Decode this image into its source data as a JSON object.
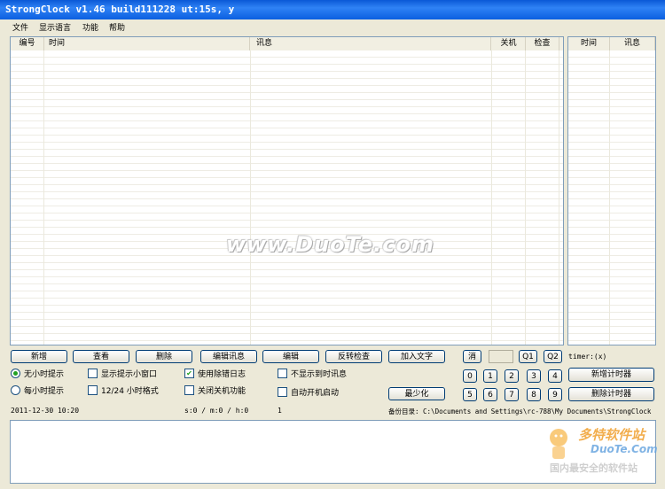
{
  "title": "StrongClock v1.46 build111228 ut:15s, y",
  "menu": [
    "文件",
    "显示语言",
    "功能",
    "帮助"
  ],
  "main_table": {
    "columns": [
      "编号",
      "时间",
      "讯息",
      "关机",
      "检查"
    ]
  },
  "side_table": {
    "columns": [
      "时间",
      "讯息"
    ]
  },
  "watermark": "www.DuoTe.com",
  "buttons": {
    "add": "新增",
    "view": "查看",
    "delete": "删除",
    "edit_msg": "编辑讯息",
    "edit": "编辑",
    "reverse_check": "反转检查",
    "add_text": "加入文字",
    "minimize": "最少化",
    "cancel": "消",
    "q1": "Q1",
    "q2": "Q2",
    "add_timer": "新增计时器",
    "delete_timer": "删除计时器"
  },
  "numpad": [
    "0",
    "1",
    "2",
    "3",
    "4",
    "5",
    "6",
    "7",
    "8",
    "9"
  ],
  "options": {
    "no_hourly": "无小时提示",
    "each_hour": "每小时提示",
    "show_small_window": "显示提示小窗口",
    "format_12_24": "12/24 小时格式",
    "use_debug_log": "使用除错日志",
    "disable_shutdown": "关闭关机功能",
    "hide_expired": "不显示到时讯息",
    "auto_start": "自动开机启动"
  },
  "timer_label": "timer:(x)",
  "status": {
    "datetime": "2011-12-30 10:20",
    "counters": "s:0 / m:0 / h:0",
    "count": "1",
    "backup_dir": "备份目录: C:\\Documents and Settings\\rc-788\\My Documents\\StrongClock"
  },
  "logo": {
    "brand": "多特软件站",
    "site": "DuoTe.Com",
    "slogan": "国内最安全的软件站"
  },
  "colors": {
    "accent": "#0a58d6",
    "check": "#21a121"
  }
}
